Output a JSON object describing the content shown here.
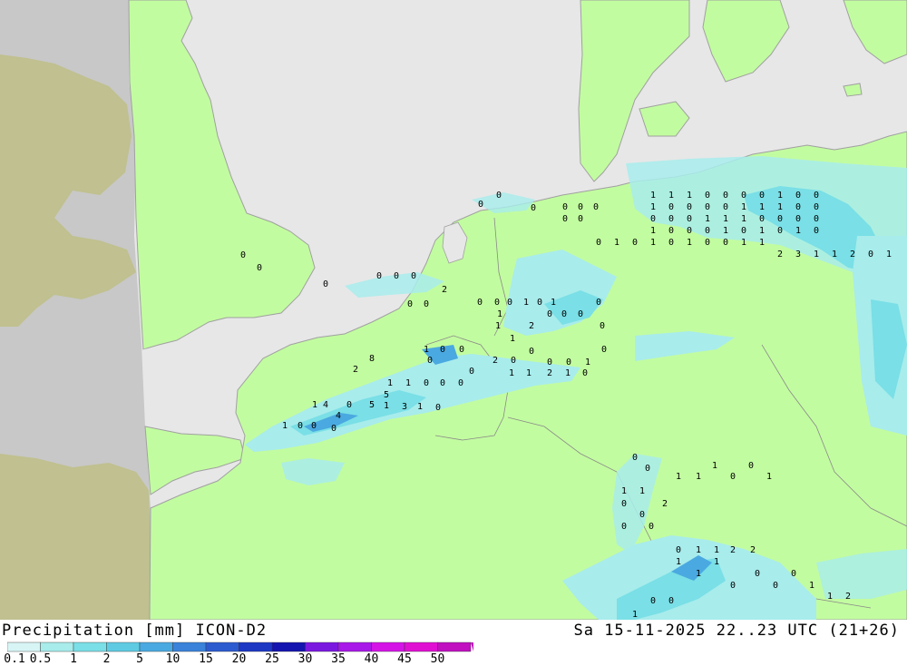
{
  "title": "Precipitation [mm] ICON-D2",
  "timestamp": "Sa 15-11-2025 22..23 UTC (21+26)",
  "legend": {
    "labels": [
      "0.1",
      "0.5",
      "1",
      "2",
      "5",
      "10",
      "15",
      "20",
      "25",
      "30",
      "35",
      "40",
      "45",
      "50"
    ],
    "colors": [
      "#d8f5f5",
      "#a8ecec",
      "#7adfe6",
      "#5fcbe3",
      "#4aa9e0",
      "#3a82da",
      "#2c5bd0",
      "#1e38c4",
      "#1414b0",
      "#7a18e0",
      "#a818e8",
      "#d414e6",
      "#e010d2",
      "#c010c0"
    ]
  },
  "colors": {
    "sea": "#e7e7e7",
    "land_in_domain": "#c2fca0",
    "outside_domain_sea": "#c8c8c8",
    "outside_domain_land": "#c0c090",
    "coast": "#a0a0a0",
    "light_precip": "#a8ecec",
    "moderate_precip": "#7adfe6",
    "heavy_precip": "#4aa9e0"
  },
  "station_values": [
    {
      "v": "0"
    },
    {
      "v": "0"
    },
    {
      "v": "0"
    },
    {
      "v": "0"
    },
    {
      "v": "0"
    },
    {
      "v": "0"
    },
    {
      "v": "0"
    },
    {
      "v": "2"
    },
    {
      "v": "0"
    },
    {
      "v": "0"
    },
    {
      "v": "0"
    },
    {
      "v": "0"
    },
    {
      "v": "0"
    },
    {
      "v": "0"
    },
    {
      "v": "0"
    },
    {
      "v": "1"
    },
    {
      "v": "0"
    },
    {
      "v": "0"
    },
    {
      "v": "2"
    },
    {
      "v": "0"
    },
    {
      "v": "0"
    },
    {
      "v": "4"
    },
    {
      "v": "0"
    },
    {
      "v": "0"
    },
    {
      "v": "1"
    },
    {
      "v": "4"
    },
    {
      "v": "0"
    },
    {
      "v": "0"
    },
    {
      "v": "1"
    },
    {
      "v": "5"
    },
    {
      "v": "1"
    },
    {
      "v": "5"
    },
    {
      "v": "3"
    },
    {
      "v": "1"
    },
    {
      "v": "0"
    },
    {
      "v": "1"
    },
    {
      "v": "1"
    },
    {
      "v": "0"
    },
    {
      "v": "0"
    },
    {
      "v": "0"
    },
    {
      "v": "0"
    },
    {
      "v": "2"
    },
    {
      "v": "1"
    },
    {
      "v": "0"
    },
    {
      "v": "0"
    },
    {
      "v": "1"
    },
    {
      "v": "2"
    },
    {
      "v": "0"
    },
    {
      "v": "0"
    },
    {
      "v": "0"
    },
    {
      "v": "0"
    },
    {
      "v": "1"
    },
    {
      "v": "1"
    },
    {
      "v": "0"
    },
    {
      "v": "0"
    },
    {
      "v": "0"
    },
    {
      "v": "1"
    },
    {
      "v": "0"
    },
    {
      "v": "1"
    },
    {
      "v": "1"
    },
    {
      "v": "0"
    },
    {
      "v": "0"
    },
    {
      "v": "1"
    },
    {
      "v": "1"
    },
    {
      "v": "1"
    },
    {
      "v": "0"
    },
    {
      "v": "0"
    },
    {
      "v": "1"
    },
    {
      "v": "1"
    },
    {
      "v": "1"
    },
    {
      "v": "2"
    },
    {
      "v": "0"
    },
    {
      "v": "0"
    },
    {
      "v": "0"
    },
    {
      "v": "0"
    },
    {
      "v": "0"
    },
    {
      "v": "1"
    },
    {
      "v": "1"
    },
    {
      "v": "2"
    },
    {
      "v": "2"
    },
    {
      "v": "1"
    },
    {
      "v": "1"
    },
    {
      "v": "1"
    },
    {
      "v": "0"
    },
    {
      "v": "0"
    },
    {
      "v": "0"
    },
    {
      "v": "0"
    },
    {
      "v": "1"
    },
    {
      "v": "1"
    },
    {
      "v": "2"
    },
    {
      "v": "1"
    },
    {
      "v": "1"
    },
    {
      "v": "1"
    },
    {
      "v": "0"
    },
    {
      "v": "0"
    },
    {
      "v": "0"
    },
    {
      "v": "0"
    },
    {
      "v": "1"
    },
    {
      "v": "0"
    },
    {
      "v": "0"
    },
    {
      "v": "1"
    },
    {
      "v": "0"
    },
    {
      "v": "0"
    },
    {
      "v": "0"
    },
    {
      "v": "0"
    },
    {
      "v": "1"
    },
    {
      "v": "1"
    },
    {
      "v": "1"
    },
    {
      "v": "0"
    },
    {
      "v": "0"
    },
    {
      "v": "0"
    },
    {
      "v": "0"
    },
    {
      "v": "0"
    },
    {
      "v": "1"
    },
    {
      "v": "1"
    },
    {
      "v": "1"
    },
    {
      "v": "0"
    },
    {
      "v": "0"
    },
    {
      "v": "0"
    },
    {
      "v": "0"
    },
    {
      "v": "1"
    },
    {
      "v": "0"
    },
    {
      "v": "0"
    },
    {
      "v": "0"
    },
    {
      "v": "1"
    },
    {
      "v": "0"
    },
    {
      "v": "1"
    },
    {
      "v": "0"
    },
    {
      "v": "1"
    },
    {
      "v": "0"
    },
    {
      "v": "0"
    },
    {
      "v": "1"
    },
    {
      "v": "0"
    },
    {
      "v": "1"
    },
    {
      "v": "0"
    },
    {
      "v": "1"
    },
    {
      "v": "0"
    },
    {
      "v": "0"
    },
    {
      "v": "1"
    },
    {
      "v": "1"
    },
    {
      "v": "2"
    },
    {
      "v": "3"
    },
    {
      "v": "1"
    },
    {
      "v": "1"
    },
    {
      "v": "2"
    },
    {
      "v": "0"
    },
    {
      "v": "1"
    },
    {
      "v": "1"
    },
    {
      "v": "0"
    },
    {
      "v": "0"
    },
    {
      "v": "8"
    },
    {
      "v": "2"
    },
    {
      "v": "0"
    },
    {
      "v": "0"
    },
    {
      "v": "0"
    },
    {
      "v": "0"
    },
    {
      "v": "0"
    },
    {
      "v": "1"
    },
    {
      "v": "0"
    },
    {
      "v": "1"
    }
  ]
}
